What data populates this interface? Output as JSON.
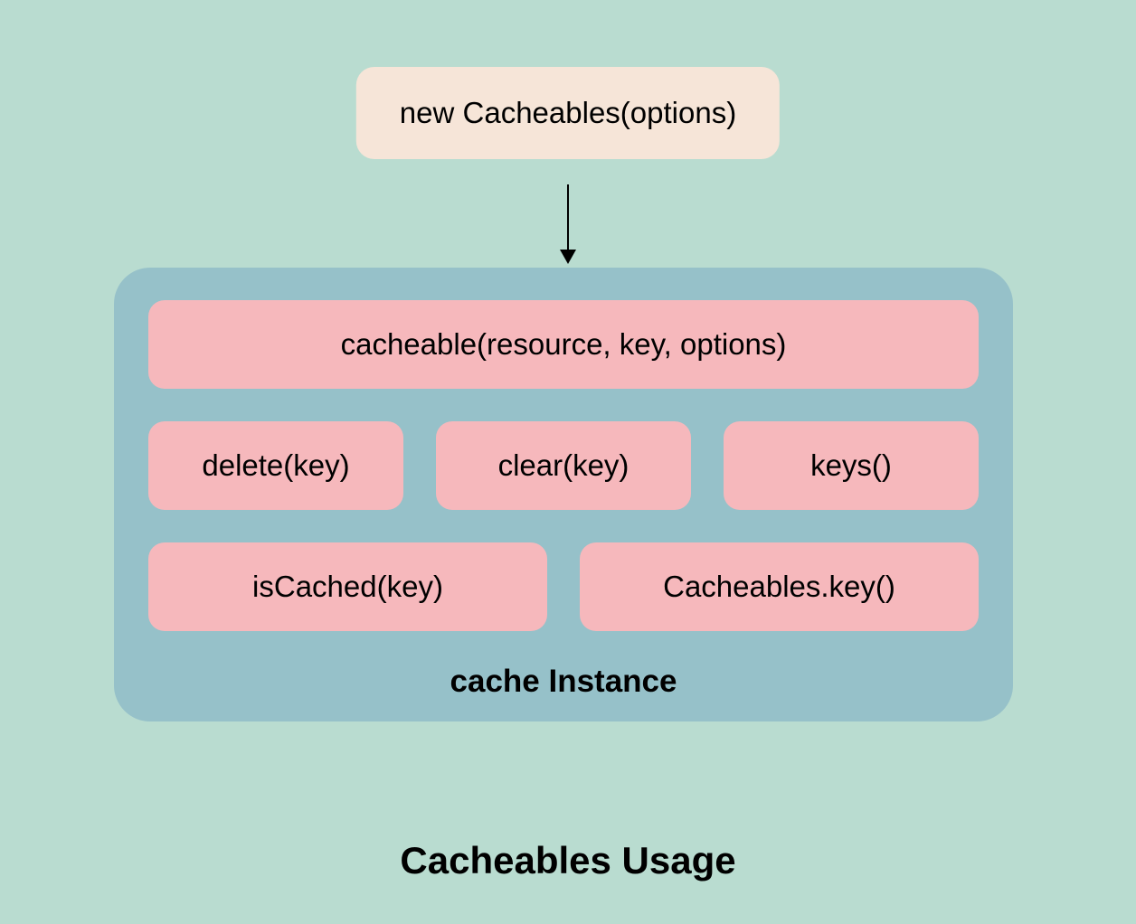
{
  "constructor": {
    "label": "new Cacheables(options)"
  },
  "instance": {
    "label": "cache Instance",
    "methods": {
      "row1": [
        {
          "label": "cacheable(resource, key, options)"
        }
      ],
      "row2": [
        {
          "label": "delete(key)"
        },
        {
          "label": "clear(key)"
        },
        {
          "label": "keys()"
        }
      ],
      "row3": [
        {
          "label": "isCached(key)"
        },
        {
          "label": "Cacheables.key()"
        }
      ]
    }
  },
  "title": "Cacheables Usage",
  "colors": {
    "background": "#b9dcd0",
    "constructorBox": "#f6e5d8",
    "instanceBox": "#96c1c9",
    "methodBox": "#f6b8bc"
  }
}
